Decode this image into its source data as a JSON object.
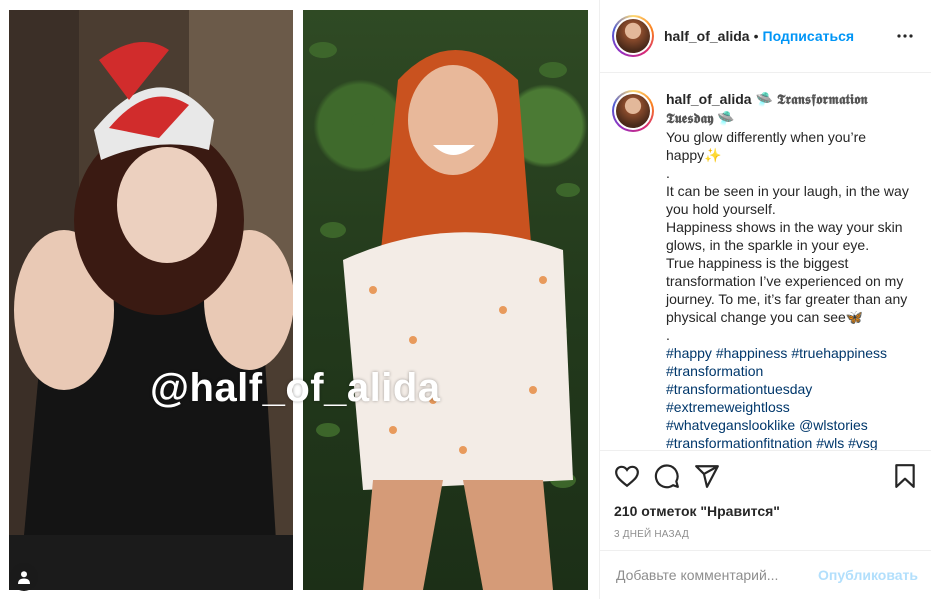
{
  "post": {
    "watermark": "@half_of_alida",
    "username": "half_of_alida",
    "follow_label": "Подписаться",
    "dot": "•"
  },
  "caption": {
    "username": "half_of_alida",
    "title_emoji_left": "🛸",
    "title": "𝕿𝖗𝖆𝖓𝖘𝖋𝖔𝖗𝖒𝖆𝖙𝖎𝖔𝖓 𝕿𝖚𝖊𝖘𝖉𝖆𝖞",
    "title_emoji_right": "🛸",
    "lines": [
      "You glow differently when you’re happy✨",
      ".",
      "It can be seen in your laugh, in the way you hold yourself.",
      "Happiness shows in the way your skin glows, in the sparkle in your eye.",
      "True happiness is the biggest transformation I’ve experienced on my journey. To me, it’s far greater than any physical change you can see🦋",
      "."
    ],
    "hashtags": [
      "#happy #happiness #truehappiness #transformation",
      "#transformationtuesday",
      "#extremeweightloss",
      "#whatveganslooklike @wlstories",
      "#transformationfitnation #wls #vsg"
    ]
  },
  "actions": {
    "likes": "210 отметок \"Нравится\"",
    "time": "3 дней назад"
  },
  "comment": {
    "placeholder": "Добавьте комментарий...",
    "publish_label": "Опубликовать"
  },
  "colors": {
    "link": "#0095f6",
    "hashtag": "#00376b",
    "publish_disabled": "#b2dffc"
  }
}
